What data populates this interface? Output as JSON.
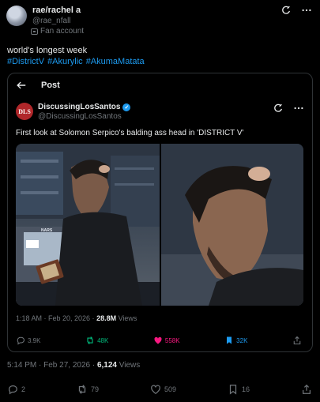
{
  "author": {
    "name": "rae/rachel a",
    "handle": "@rae_nfall",
    "badge": "Fan account"
  },
  "tweet": {
    "text": "world's longest week",
    "hashtags": [
      "#DistrictV",
      "#Akurylic",
      "#AkumaMatata"
    ]
  },
  "quote": {
    "header": "Post",
    "author_name": "DiscussingLosSantos",
    "author_handle": "@DiscussingLosSantos",
    "avatar_text": "DLS",
    "text": "First look at Solomon Serpico's balding ass head in 'DISTRICT V'",
    "timestamp": "1:18 AM · Feb 20, 2026 · ",
    "views_count": "28.8M",
    "views_label": " Views",
    "stats": {
      "replies": "3.9K",
      "reposts": "48K",
      "likes": "558K",
      "bookmarks": "32K"
    },
    "media_text": "NARS"
  },
  "footer": {
    "timestamp": "5:14 PM · Feb 27, 2026 · ",
    "views_count": "6,124",
    "views_label": " Views"
  },
  "actions": {
    "replies": "2",
    "reposts": "79",
    "likes": "509",
    "bookmarks": "16"
  },
  "colors": {
    "accent": "#1d9bf0",
    "repost": "#00ba7c",
    "like": "#f91880",
    "muted": "#71767b"
  }
}
